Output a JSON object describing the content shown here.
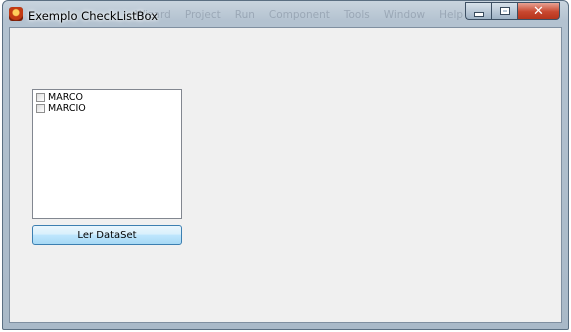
{
  "window": {
    "title": "Exemplo CheckListBox",
    "ghost_menu": [
      "Wizard",
      "Project",
      "Run",
      "Component",
      "Tools",
      "Window",
      "Help"
    ]
  },
  "checklist": {
    "items": [
      {
        "label": "MARCO",
        "checked": false
      },
      {
        "label": "MARCIO",
        "checked": false
      }
    ]
  },
  "buttons": {
    "read_dataset": "Ler DataSet"
  },
  "icons": {
    "app": "delphi-app-icon",
    "minimize": "minimize-icon",
    "maximize": "maximize-icon",
    "close": "close-icon"
  },
  "colors": {
    "client_bg": "#f0f0f0",
    "close_button": "#c8472f",
    "button_border": "#3c7fb1"
  }
}
